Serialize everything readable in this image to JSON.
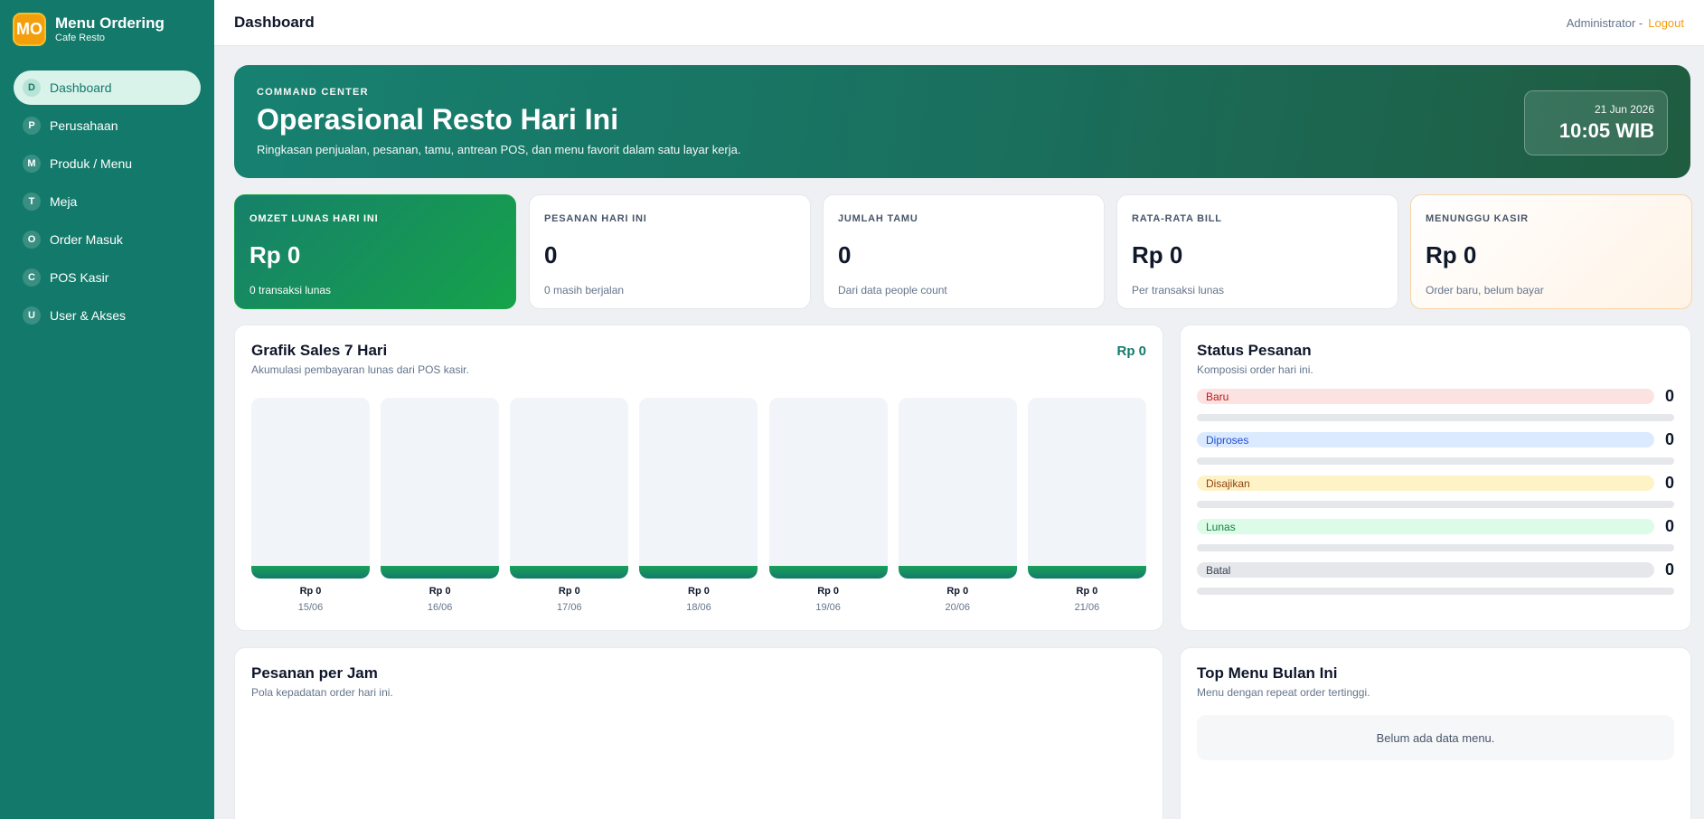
{
  "brand": {
    "logo": "MO",
    "title": "Menu Ordering",
    "subtitle": "Cafe Resto"
  },
  "nav": [
    {
      "badge": "D",
      "label": "Dashboard",
      "active": true
    },
    {
      "badge": "P",
      "label": "Perusahaan"
    },
    {
      "badge": "M",
      "label": "Produk / Menu"
    },
    {
      "badge": "T",
      "label": "Meja"
    },
    {
      "badge": "O",
      "label": "Order Masuk"
    },
    {
      "badge": "C",
      "label": "POS Kasir"
    },
    {
      "badge": "U",
      "label": "User & Akses"
    }
  ],
  "topbar": {
    "title": "Dashboard",
    "user": "Administrator -",
    "logout": "Logout"
  },
  "hero": {
    "eyebrow": "COMMAND CENTER",
    "title": "Operasional Resto Hari Ini",
    "subtitle": "Ringkasan penjualan, pesanan, tamu, antrean POS, dan menu favorit dalam satu layar kerja.",
    "date": "21 Jun 2026",
    "time": "10:05 WIB"
  },
  "stats": [
    {
      "label": "OMZET LUNAS HARI INI",
      "value": "Rp 0",
      "note": "0 transaksi lunas"
    },
    {
      "label": "PESANAN HARI INI",
      "value": "0",
      "note": "0 masih berjalan"
    },
    {
      "label": "JUMLAH TAMU",
      "value": "0",
      "note": "Dari data people count"
    },
    {
      "label": "RATA-RATA BILL",
      "value": "Rp 0",
      "note": "Per transaksi lunas"
    },
    {
      "label": "MENUNGGU KASIR",
      "value": "Rp 0",
      "note": "Order baru, belum bayar"
    }
  ],
  "sales": {
    "title": "Grafik Sales 7 Hari",
    "subtitle": "Akumulasi pembayaran lunas dari POS kasir.",
    "total": "Rp 0"
  },
  "chart_data": {
    "type": "bar",
    "categories": [
      "15/06",
      "16/06",
      "17/06",
      "18/06",
      "19/06",
      "20/06",
      "21/06"
    ],
    "values": [
      0,
      0,
      0,
      0,
      0,
      0,
      0
    ],
    "value_labels": [
      "Rp 0",
      "Rp 0",
      "Rp 0",
      "Rp 0",
      "Rp 0",
      "Rp 0",
      "Rp 0"
    ],
    "title": "Grafik Sales 7 Hari",
    "xlabel": "",
    "ylabel": ""
  },
  "status": {
    "title": "Status Pesanan",
    "subtitle": "Komposisi order hari ini.",
    "items": [
      {
        "label": "Baru",
        "count": "0",
        "value": 0,
        "bg": "#fde2e2",
        "fg": "#b91c1c"
      },
      {
        "label": "Diproses",
        "count": "0",
        "value": 0,
        "bg": "#dbeafe",
        "fg": "#1d4ed8"
      },
      {
        "label": "Disajikan",
        "count": "0",
        "value": 0,
        "bg": "#fef3c7",
        "fg": "#92400e"
      },
      {
        "label": "Lunas",
        "count": "0",
        "value": 0,
        "bg": "#dcfce7",
        "fg": "#15803d"
      },
      {
        "label": "Batal",
        "count": "0",
        "value": 0,
        "bg": "#e5e7eb",
        "fg": "#374151"
      }
    ]
  },
  "hourly": {
    "title": "Pesanan per Jam",
    "subtitle": "Pola kepadatan order hari ini."
  },
  "topmenu": {
    "title": "Top Menu Bulan Ini",
    "subtitle": "Menu dengan repeat order tertinggi.",
    "empty": "Belum ada data menu."
  }
}
